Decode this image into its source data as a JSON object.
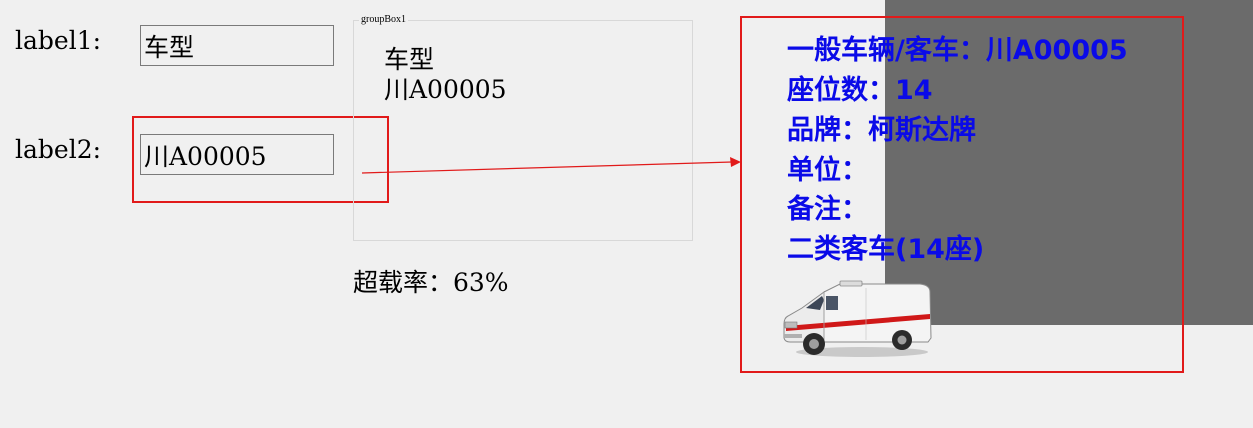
{
  "form": {
    "label1": "label1:",
    "label2": "label2:",
    "textbox1_value": "车型",
    "textbox2_value": "川A00005"
  },
  "group_box": {
    "title": "groupBox1",
    "line1": "车型",
    "line2": "川A00005"
  },
  "overload_rate": "超载率：63%",
  "info_panel": {
    "lines": [
      "一般车辆/客车：川A00005",
      "座位数：14",
      "品牌：柯斯达牌",
      "单位：",
      "备注：",
      "二类客车(14座)"
    ],
    "vehicle_image": "ambulance-van-icon"
  },
  "colors": {
    "highlight_red": "#e11a1a",
    "info_blue": "#0a0ae8",
    "panel_gray": "#6b6b6b",
    "background": "#f0f0f0"
  }
}
